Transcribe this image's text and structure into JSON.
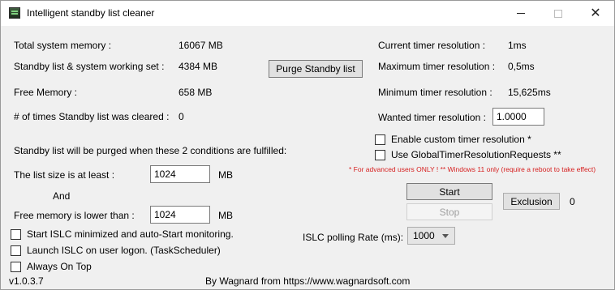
{
  "window": {
    "title": "Intelligent standby list cleaner"
  },
  "stats": {
    "total_label": "Total system memory :",
    "total_value": "16067 MB",
    "standby_label": "Standby list & system working set :",
    "standby_value": "4384 MB",
    "free_label": "Free Memory :",
    "free_value": "658 MB",
    "cleared_label": "# of times Standby list was cleared :",
    "cleared_value": "0"
  },
  "timer": {
    "current_label": "Current timer resolution :",
    "current_value": "1ms",
    "max_label": "Maximum timer resolution :",
    "max_value": "0,5ms",
    "min_label": "Minimum timer resolution :",
    "min_value": "15,625ms",
    "wanted_label": "Wanted timer resolution :",
    "wanted_value": "1.0000"
  },
  "buttons": {
    "purge": "Purge Standby list",
    "start": "Start",
    "stop": "Stop",
    "exclusion": "Exclusion",
    "exclusion_count": "0"
  },
  "conditions": {
    "heading": "Standby list will be purged when these 2 conditions are fulfilled:",
    "list_size_label": "The list size is at least :",
    "list_size_value": "1024",
    "list_size_unit": "MB",
    "and_label": "And",
    "free_mem_label": "Free memory is lower than :",
    "free_mem_value": "1024",
    "free_mem_unit": "MB"
  },
  "options": {
    "custom_timer": "Enable custom timer resolution *",
    "global_timer": "Use GlobalTimerResolutionRequests **",
    "warning": "* For advanced users ONLY !  ** Windows 11 only (require a reboot to take effect)",
    "start_minimized": "Start ISLC minimized and auto-Start monitoring.",
    "launch_logon": "Launch ISLC on user logon. (TaskScheduler)",
    "always_on_top": "Always On Top"
  },
  "polling": {
    "label": "ISLC polling Rate (ms):",
    "value": "1000"
  },
  "footer": {
    "version": "v1.0.3.7",
    "credit": "By Wagnard from https://www.wagnardsoft.com"
  }
}
